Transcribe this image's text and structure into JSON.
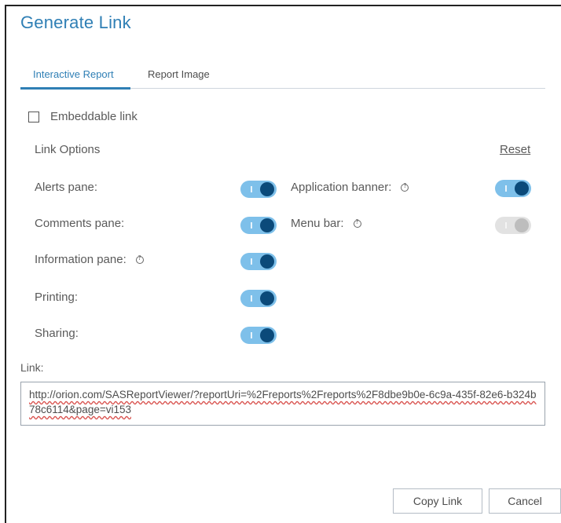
{
  "dialog": {
    "title": "Generate Link",
    "tabs": [
      {
        "label": "Interactive Report",
        "active": true
      },
      {
        "label": "Report Image",
        "active": false
      }
    ],
    "embeddable": {
      "label": "Embeddable link",
      "checked": false
    },
    "link_options_title": "Link Options",
    "reset_label": "Reset",
    "options_left": [
      {
        "label": "Alerts pane:",
        "on": true,
        "help": false
      },
      {
        "label": "Comments pane:",
        "on": true,
        "help": false
      },
      {
        "label": "Information pane:",
        "on": true,
        "help": true
      },
      {
        "label": "Printing:",
        "on": true,
        "help": false
      },
      {
        "label": "Sharing:",
        "on": true,
        "help": false
      }
    ],
    "options_right": [
      {
        "label": "Application banner:",
        "on": true,
        "help": true,
        "disabled": false
      },
      {
        "label": "Menu bar:",
        "on": true,
        "help": true,
        "disabled": true
      }
    ],
    "link_label": "Link:",
    "link_value": "http://orion.com/SASReportViewer/?reportUri=%2Freports%2Freports%2F8dbe9b0e-6c9a-435f-82e6-b324b78c6114&page=vi153",
    "buttons": {
      "copy": "Copy Link",
      "cancel": "Cancel"
    },
    "colors": {
      "accent": "#2f7fb5",
      "toggle_track": "#7ec0ea",
      "toggle_knob": "#0b4a7a",
      "disabled_track": "#e2e2e2"
    }
  }
}
